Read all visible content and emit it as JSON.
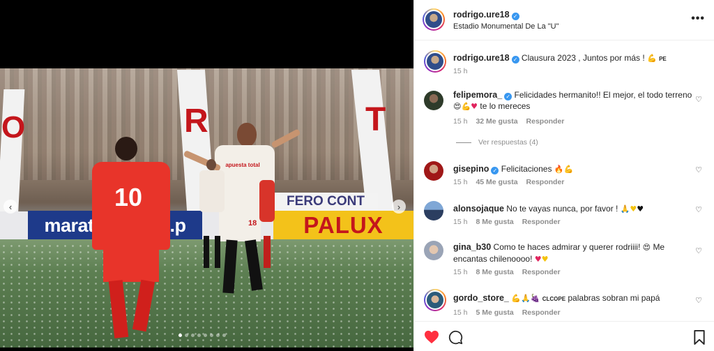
{
  "post": {
    "username": "rodrigo.ure18",
    "location": "Estadio Monumental De La \"U\"",
    "more_label": "•••",
    "caption_text": "Clausura 2023 , Juntos por más !",
    "caption_tag": "PE",
    "caption_time": "15 h"
  },
  "media": {
    "jersey_red": "10",
    "jersey_white": "18",
    "sponsor_white": "apuesta total",
    "board_marathon": "marathon.com.p",
    "board_palux": "PALUX",
    "board_contact": "FERO CONT",
    "pillar_letters": [
      "O",
      "R",
      "T"
    ],
    "prev_icon": "‹",
    "next_icon": "›",
    "dot_count": 8,
    "active_dot": 0
  },
  "comments": [
    {
      "username": "felipemora_",
      "verified": true,
      "text": "Felicidades hermanito!! El mejor, el todo terreno",
      "text_tail": "te lo mereces",
      "time": "15 h",
      "likes": "32 Me gusta",
      "reply": "Responder"
    },
    {
      "username": "gisepino",
      "verified": true,
      "text": "Felicitaciones",
      "time": "15 h",
      "likes": "45 Me gusta",
      "reply": "Responder"
    },
    {
      "username": "alonsojaque",
      "verified": false,
      "text": "No te vayas nunca, por favor !",
      "time": "15 h",
      "likes": "8 Me gusta",
      "reply": "Responder"
    },
    {
      "username": "gina_b30",
      "verified": false,
      "text": "Como te haces admirar y querer rodriiii!",
      "text_tail": "Me encantas chilenoooo!",
      "time": "15 h",
      "likes": "8 Me gusta",
      "reply": "Responder"
    },
    {
      "username": "gordo_store_",
      "verified": false,
      "text_tag": "CLCOPE",
      "text": "palabras sobran mi papá",
      "time": "15 h",
      "likes": "5 Me gusta",
      "reply": "Responder"
    }
  ],
  "replies_link": "Ver respuestas (4)",
  "icons": {
    "verified": "verified-badge-icon",
    "like": "heart-icon",
    "comment": "comment-icon",
    "save": "bookmark-icon"
  },
  "colors": {
    "like_red": "#ff3040",
    "verified_blue": "#3897f0",
    "meta_gray": "#8e8e8e"
  }
}
